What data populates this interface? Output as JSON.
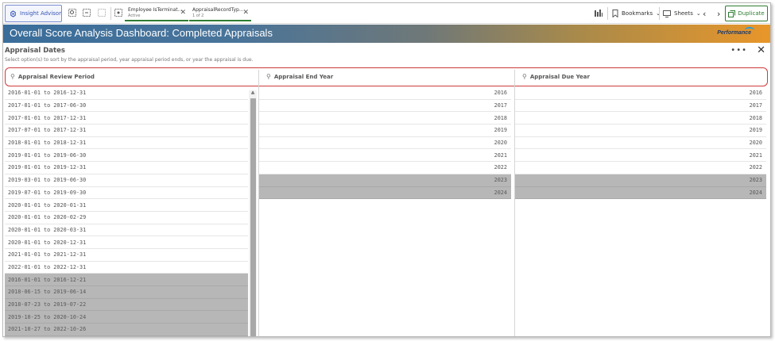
{
  "toolbar": {
    "insight_label": "Insight Advisor",
    "chips": [
      {
        "title": "Employee IsTerminat...",
        "sub": "Active"
      },
      {
        "title": "AppraisalRecordTyp...",
        "sub": "1 of 2"
      }
    ],
    "bookmarks_label": "Bookmarks",
    "sheets_label": "Sheets",
    "duplicate_label": "Duplicate"
  },
  "banner": {
    "title": "Overall Score Analysis Dashboard: Completed Appraisals",
    "logo_text": "Performance"
  },
  "panel": {
    "title": "Appraisal Dates",
    "subtitle": "Select option(s) to sort by the appraisal period, year appraisal period ends, or year the appraisal is due."
  },
  "columns": {
    "review_period": {
      "header": "Appraisal Review Period",
      "rows": [
        {
          "v": "2016-01-01 to 2016-12-31",
          "s": 0
        },
        {
          "v": "2017-01-01 to 2017-06-30",
          "s": 0
        },
        {
          "v": "2017-01-01 to 2017-12-31",
          "s": 0
        },
        {
          "v": "2017-07-01 to 2017-12-31",
          "s": 0
        },
        {
          "v": "2018-01-01 to 2018-12-31",
          "s": 0
        },
        {
          "v": "2019-01-01 to 2019-06-30",
          "s": 0
        },
        {
          "v": "2019-01-01 to 2019-12-31",
          "s": 0
        },
        {
          "v": "2019-03-01 to 2019-06-30",
          "s": 0
        },
        {
          "v": "2019-07-01 to 2019-09-30",
          "s": 0
        },
        {
          "v": "2020-01-01 to 2020-01-31",
          "s": 0
        },
        {
          "v": "2020-01-01 to 2020-02-29",
          "s": 0
        },
        {
          "v": "2020-01-01 to 2020-03-31",
          "s": 0
        },
        {
          "v": "2020-01-01 to 2020-12-31",
          "s": 0
        },
        {
          "v": "2021-01-01 to 2021-12-31",
          "s": 0
        },
        {
          "v": "2022-01-01 to 2022-12-31",
          "s": 0
        },
        {
          "v": "2016-01-01 to 2016-12-21",
          "s": 1
        },
        {
          "v": "2018-06-15 to 2019-06-14",
          "s": 1
        },
        {
          "v": "2018-07-23 to 2019-07-22",
          "s": 1
        },
        {
          "v": "2019-10-25 to 2020-10-24",
          "s": 1
        },
        {
          "v": "2021-10-27 to 2022-10-26",
          "s": 1
        }
      ]
    },
    "end_year": {
      "header": "Appraisal End Year",
      "rows": [
        {
          "v": "2016",
          "s": 0
        },
        {
          "v": "2017",
          "s": 0
        },
        {
          "v": "2018",
          "s": 0
        },
        {
          "v": "2019",
          "s": 0
        },
        {
          "v": "2020",
          "s": 0
        },
        {
          "v": "2021",
          "s": 0
        },
        {
          "v": "2022",
          "s": 0
        },
        {
          "v": "2023",
          "s": 1
        },
        {
          "v": "2024",
          "s": 1
        }
      ]
    },
    "due_year": {
      "header": "Appraisal Due Year",
      "rows": [
        {
          "v": "2016",
          "s": 0
        },
        {
          "v": "2017",
          "s": 0
        },
        {
          "v": "2018",
          "s": 0
        },
        {
          "v": "2019",
          "s": 0
        },
        {
          "v": "2020",
          "s": 0
        },
        {
          "v": "2021",
          "s": 0
        },
        {
          "v": "2022",
          "s": 0
        },
        {
          "v": "2023",
          "s": 1
        },
        {
          "v": "2024",
          "s": 1
        }
      ]
    }
  },
  "colors": {
    "selected_border": "#cf3a3a",
    "excluded_row": "#b7b7b7",
    "duplicate_green": "#2e7d32",
    "insight_blue": "#3454b4"
  }
}
